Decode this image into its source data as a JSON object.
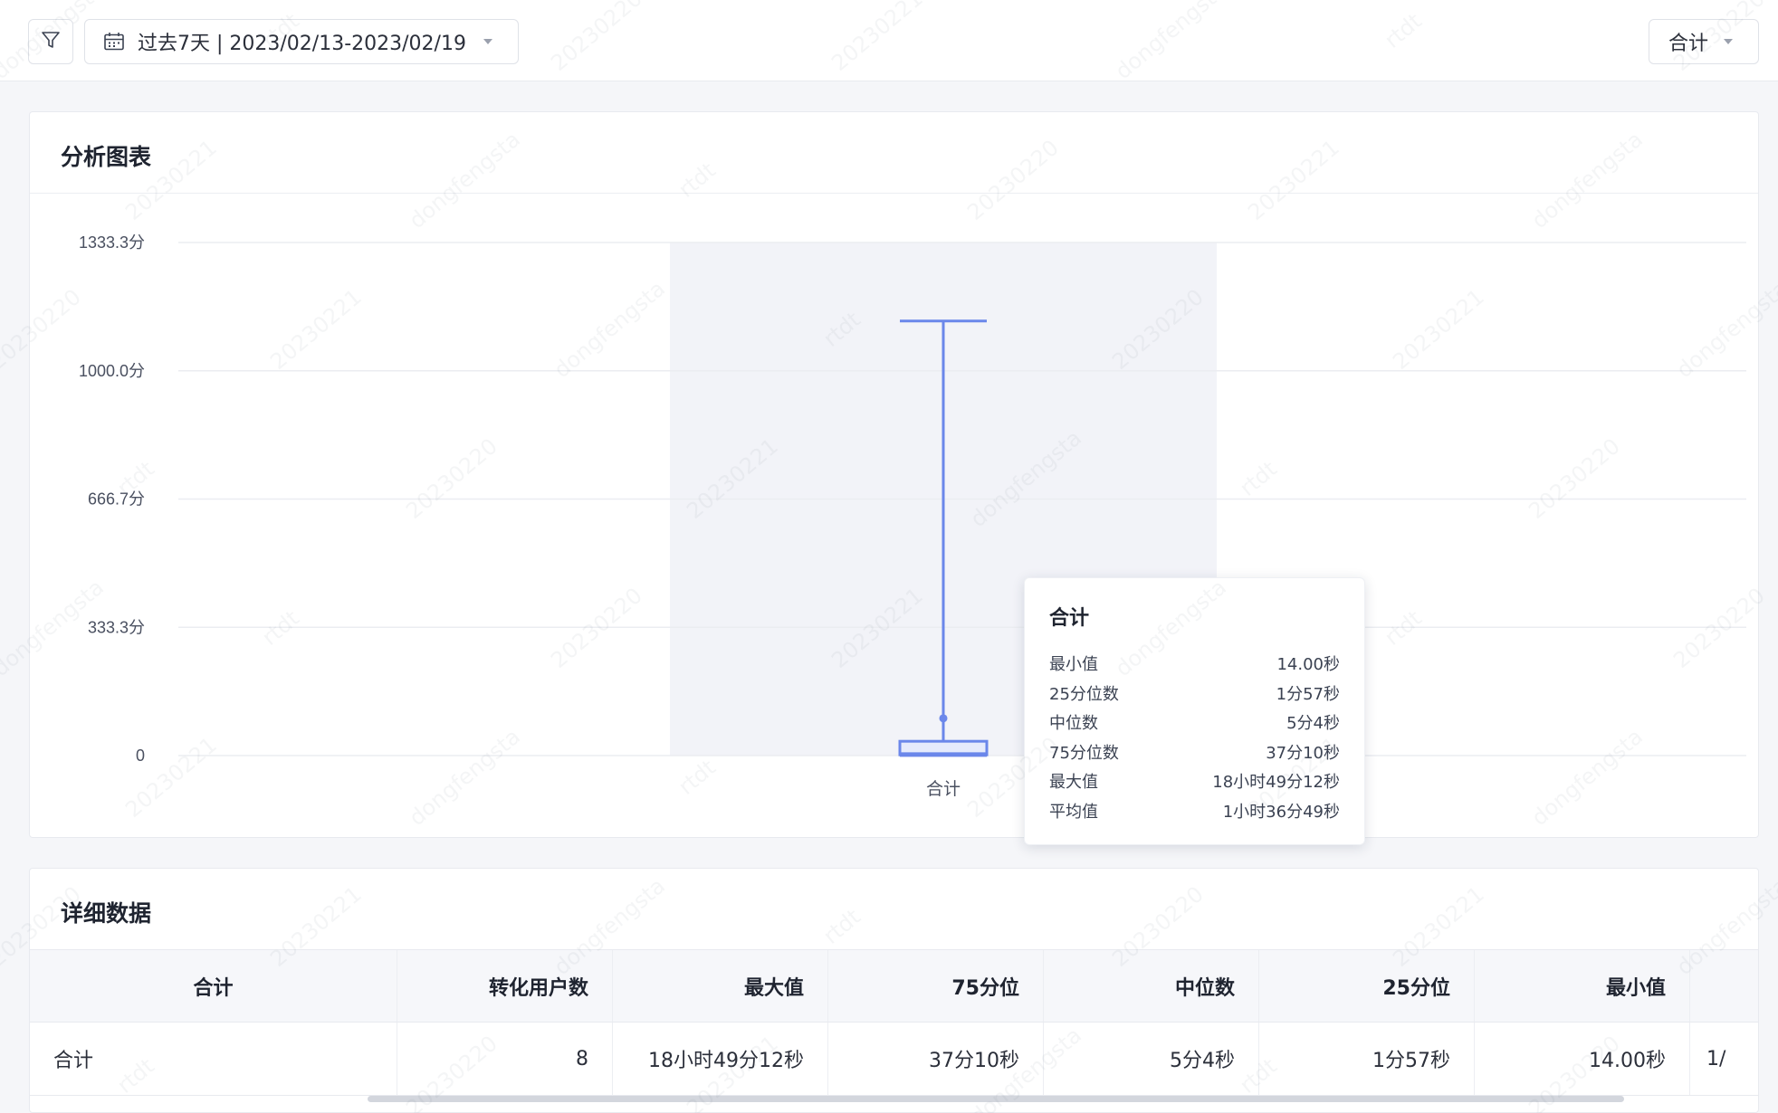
{
  "toolbar": {
    "date_range_label": "过去7天 | 2023/02/13-2023/02/19",
    "aggregate_select_value": "合计"
  },
  "chart_card": {
    "title": "分析图表"
  },
  "chart_data": {
    "type": "boxplot",
    "categories": [
      "合计"
    ],
    "y_ticks": [
      "0",
      "333.3分",
      "666.7分",
      "1000.0分",
      "1333.3分"
    ],
    "ylim": [
      0,
      1333.3
    ],
    "y_unit": "分",
    "boxes": [
      {
        "category": "合计",
        "min": 0.23,
        "q1": 1.95,
        "median": 5.07,
        "q3": 37.17,
        "max": 1129.2,
        "mean": 96.82
      }
    ],
    "grid": true,
    "colors": {
      "box": "#6b87ea",
      "hover_band": "#f2f3f8",
      "grid": "#ebedf1"
    }
  },
  "tooltip": {
    "title": "合计",
    "rows": [
      {
        "label": "最小值",
        "value": "14.00秒"
      },
      {
        "label": "25分位数",
        "value": "1分57秒"
      },
      {
        "label": "中位数",
        "value": "5分4秒"
      },
      {
        "label": "75分位数",
        "value": "37分10秒"
      },
      {
        "label": "最大值",
        "value": "18小时49分12秒"
      },
      {
        "label": "平均值",
        "value": "1小时36分49秒"
      }
    ]
  },
  "detail_card": {
    "title": "详细数据"
  },
  "table": {
    "columns": [
      "合计",
      "转化用户数",
      "最大值",
      "75分位",
      "中位数",
      "25分位",
      "最小值",
      ""
    ],
    "rows": [
      [
        "合计",
        "8",
        "18小时49分12秒",
        "37分10秒",
        "5分4秒",
        "1分57秒",
        "14.00秒",
        "1/"
      ]
    ]
  },
  "watermark": [
    "dongfengsta",
    "rtdt",
    "20230220",
    "20230221"
  ]
}
